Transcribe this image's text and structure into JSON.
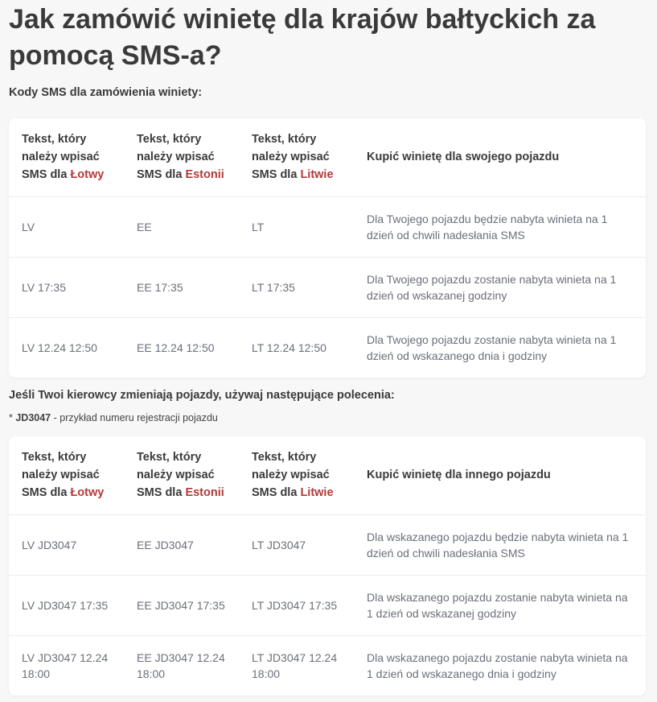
{
  "page": {
    "title": "Jak zamówić winietę dla krajów bałtyckich za pomocą SMS-a?",
    "subtitle": "Kody SMS dla zamówienia winiety:"
  },
  "table1": {
    "headers": [
      {
        "prefix": "Tekst, który należy wpisać SMS dla",
        "country": "Łotwy"
      },
      {
        "prefix": "Tekst, który należy wpisać SMS dla",
        "country": "Estonii"
      },
      {
        "prefix": "Tekst, który należy wpisać SMS dla",
        "country": "Litwie"
      },
      {
        "text": "Kupić winietę dla swojego pojazdu"
      }
    ],
    "rows": [
      [
        "LV",
        "EE",
        "LT",
        "Dla Twojego pojazdu będzie nabyta winieta na 1 dzień od chwili nadesłania SMS"
      ],
      [
        "LV 17:35",
        "EE 17:35",
        "LT 17:35",
        "Dla Twojego pojazdu zostanie nabyta winieta na 1 dzień od wskazanej godziny"
      ],
      [
        "LV 12.24 12:50",
        "EE 12.24 12:50",
        "LT 12.24 12:50",
        "Dla Twojego pojazdu zostanie nabyta winieta na 1 dzień od wskazanego dnia i godziny"
      ]
    ]
  },
  "section2": {
    "title": "Jeśli Twoi kierowcy zmieniają pojazdy, używaj następujące polecenia:",
    "note_prefix": "* ",
    "note_code": "JD3047",
    "note_text": " - przykład numeru rejestracji pojazdu"
  },
  "table2": {
    "headers": [
      {
        "prefix": "Tekst, który należy wpisać SMS dla",
        "country": "Łotwy"
      },
      {
        "prefix": "Tekst, który należy wpisać SMS dla",
        "country": "Estonii"
      },
      {
        "prefix": "Tekst, który należy wpisać SMS dla",
        "country": "Litwie"
      },
      {
        "text": "Kupić winietę dla innego pojazdu"
      }
    ],
    "rows": [
      [
        "LV JD3047",
        "EE JD3047",
        "LT JD3047",
        "Dla wskazanego pojazdu będzie nabyta winieta na 1 dzień od chwili nadesłania SMS"
      ],
      [
        "LV JD3047 17:35",
        "EE JD3047 17:35",
        "LT JD3047 17:35",
        "Dla wskazanego pojazdu zostanie nabyta winieta na 1 dzień od wskazanej godziny"
      ],
      [
        "LV JD3047 12.24 18:00",
        "EE JD3047 12.24 18:00",
        "LT JD3047 12.24 18:00",
        "Dla wskazanego pojazdu zostanie nabyta winieta na 1 dzień od wskazanego dnia i godziny"
      ]
    ]
  },
  "colors": {
    "accent": "#b23a3a",
    "heading": "#3a3a3a",
    "cell_text": "#6b6f7b",
    "background": "#f7f7f7"
  }
}
